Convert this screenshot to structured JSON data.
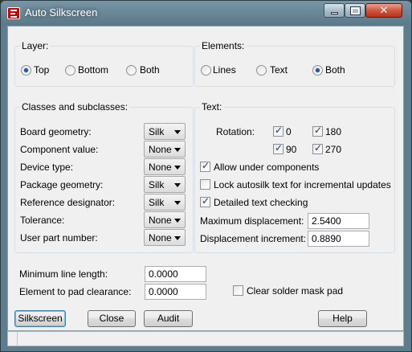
{
  "window": {
    "title": "Auto Silkscreen"
  },
  "layer": {
    "heading": "Layer:",
    "options": [
      {
        "label": "Top",
        "selected": true
      },
      {
        "label": "Bottom",
        "selected": false
      },
      {
        "label": "Both",
        "selected": false
      }
    ]
  },
  "elements": {
    "heading": "Elements:",
    "options": [
      {
        "label": "Lines",
        "selected": false
      },
      {
        "label": "Text",
        "selected": false
      },
      {
        "label": "Both",
        "selected": true
      }
    ]
  },
  "classes": {
    "heading": "Classes and subclasses:",
    "rows": [
      {
        "label": "Board geometry:",
        "value": "Silk"
      },
      {
        "label": "Component value:",
        "value": "None"
      },
      {
        "label": "Device type:",
        "value": "None"
      },
      {
        "label": "Package geometry:",
        "value": "Silk"
      },
      {
        "label": "Reference designator:",
        "value": "Silk"
      },
      {
        "label": "Tolerance:",
        "value": "None"
      },
      {
        "label": "User part number:",
        "value": "None"
      }
    ]
  },
  "text": {
    "heading": "Text:",
    "rotation_label": "Rotation:",
    "rotations": [
      {
        "label": "0",
        "checked": true
      },
      {
        "label": "180",
        "checked": true
      },
      {
        "label": "90",
        "checked": true
      },
      {
        "label": "270",
        "checked": true
      }
    ],
    "options": [
      {
        "label": "Allow under components",
        "checked": true
      },
      {
        "label": "Lock autosilk text for incremental updates",
        "checked": false
      },
      {
        "label": "Detailed text checking",
        "checked": true
      }
    ],
    "max_disp_label": "Maximum displacement:",
    "max_disp_value": "2.5400",
    "disp_inc_label": "Displacement increment:",
    "disp_inc_value": "0.8890"
  },
  "bottom": {
    "min_line_label": "Minimum line length:",
    "min_line_value": "0.0000",
    "pad_clear_label": "Element to pad clearance:",
    "pad_clear_value": "0.0000",
    "clear_mask_label": "Clear solder mask pad",
    "clear_mask_checked": false
  },
  "buttons": {
    "silkscreen": "Silkscreen",
    "close": "Close",
    "audit": "Audit",
    "help": "Help"
  }
}
